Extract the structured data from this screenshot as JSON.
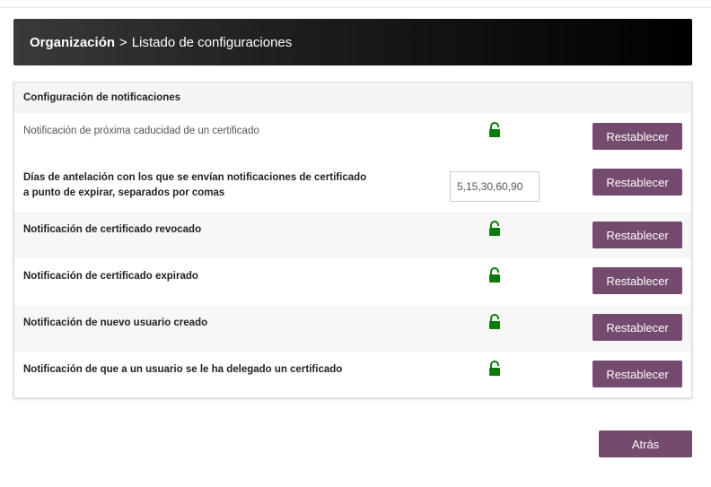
{
  "breadcrumb": {
    "root": "Organización",
    "separator": ">",
    "current": "Listado de configuraciones"
  },
  "panel": {
    "title": "Configuración de notificaciones",
    "rows": [
      {
        "label": "Notificación de próxima caducidad de un certificado",
        "control": "lock-icon",
        "button": "Restablecer"
      },
      {
        "label": "Días de antelación con los que se envían notificaciones de certificado a punto de expirar, separados por comas",
        "control": "text-input",
        "value": "5,15,30,60,90",
        "button": "Restablecer"
      },
      {
        "label": "Notificación de certificado revocado",
        "control": "lock-icon",
        "button": "Restablecer"
      },
      {
        "label": "Notificación de certificado expirado",
        "control": "lock-icon",
        "button": "Restablecer"
      },
      {
        "label": "Notificación de nuevo usuario creado",
        "control": "lock-icon",
        "button": "Restablecer"
      },
      {
        "label": "Notificación de que a un usuario se le ha delegado un certificado",
        "control": "lock-icon",
        "button": "Restablecer"
      }
    ]
  },
  "footer": {
    "back_label": "Atrás"
  },
  "colors": {
    "button": "#744a6e",
    "lock": "#0a7a0a",
    "header_start": "#3a3a3a",
    "header_end": "#000000"
  }
}
